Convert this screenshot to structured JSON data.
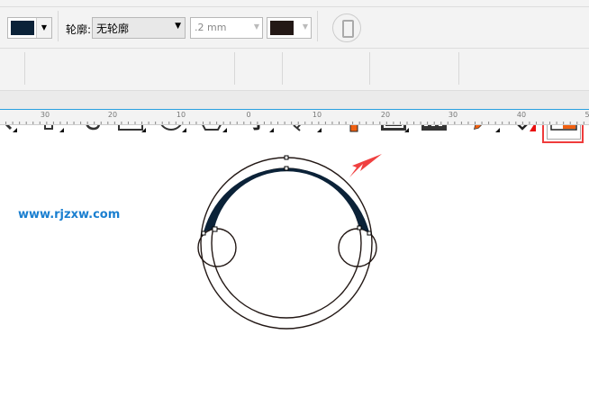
{
  "property_bar": {
    "outline_label": "轮廓:",
    "outline_value": "无轮廓",
    "width_value": ".2 mm",
    "fill_color": "#0b2238",
    "outline_color": "#231815"
  },
  "toolbox": [
    "zoom-tool",
    "freehand-pen-tool",
    "artistic-curve-tool",
    "rectangle-tool",
    "ellipse-tool",
    "polygon-tool",
    "text-tool",
    "dimension-tool",
    "connector-tool",
    "contour-tool",
    "transparency-tool",
    "eyedropper-tool",
    "interactive-fill-tool",
    "smart-fill-tool"
  ],
  "ruler": {
    "labels": [
      "30",
      "20",
      "10",
      "0",
      "10",
      "20",
      "30",
      "40",
      "5"
    ]
  },
  "watermark": "www.rjzxw.com",
  "colors": {
    "highlight": "#ef3b3b",
    "arc_fill": "#0b2238",
    "arrow": "#f04040"
  }
}
